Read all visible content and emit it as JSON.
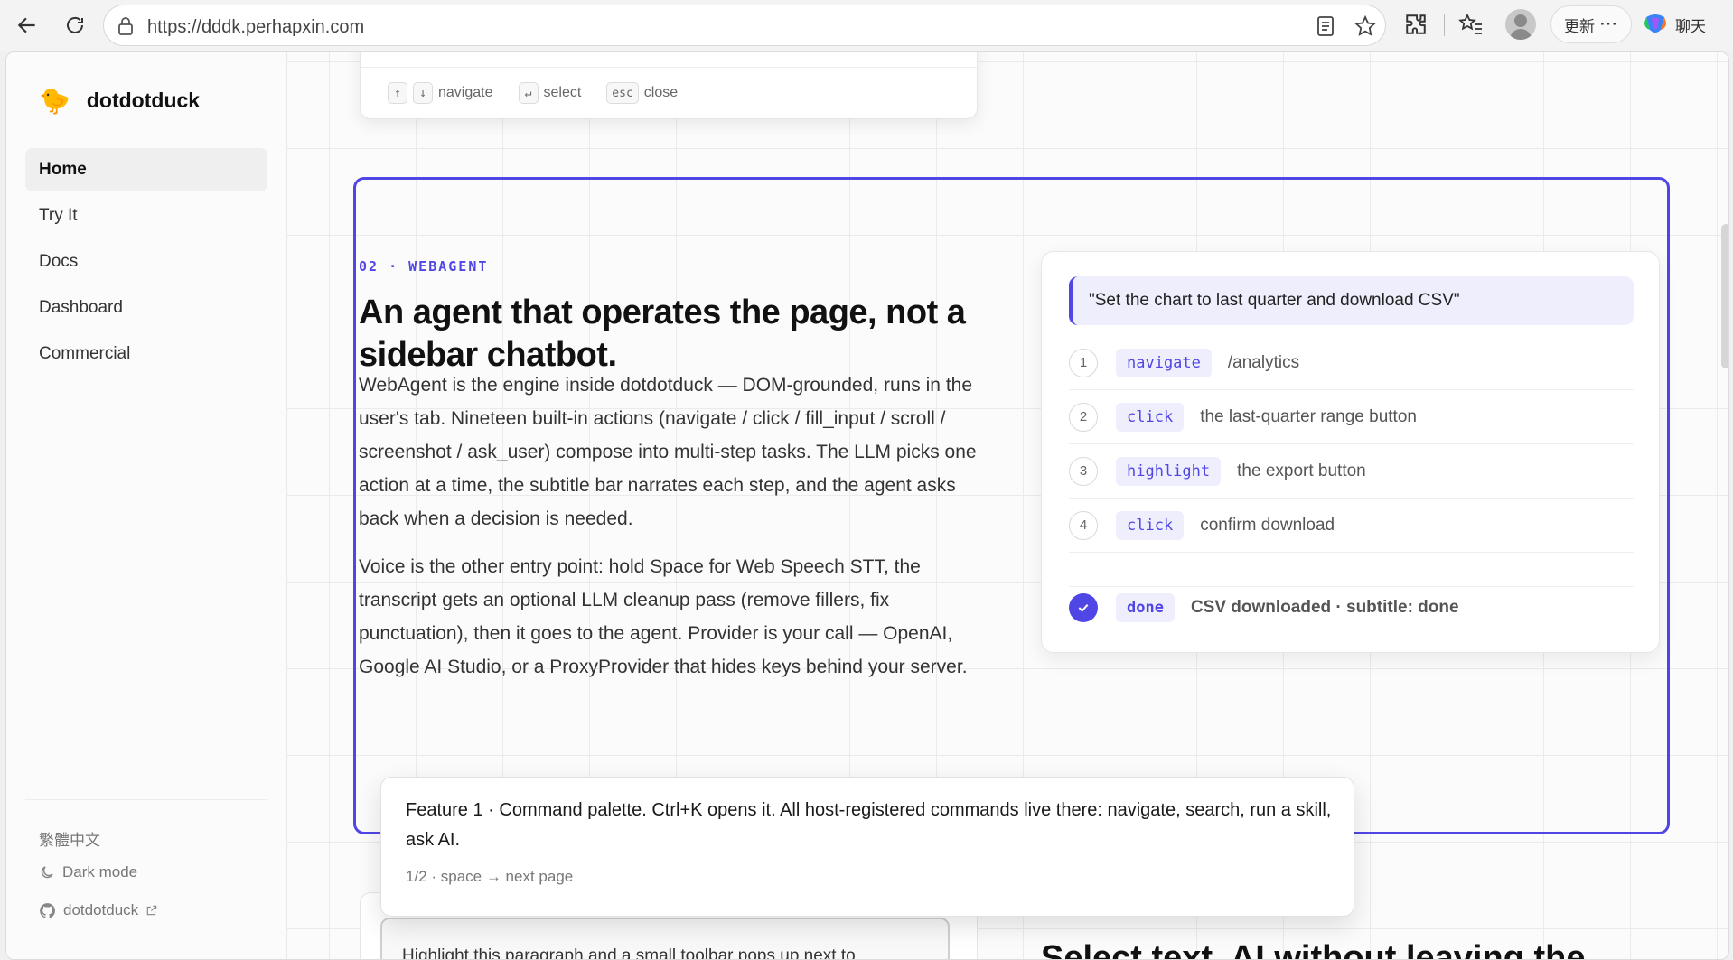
{
  "browser": {
    "url": "https://dddk.perhapxin.com",
    "update_label": "更新",
    "more_label": "···",
    "chat_label": "聊天"
  },
  "sidebar": {
    "brand": "dotdotduck",
    "brand_icon": "🐤",
    "items": [
      {
        "label": "Home",
        "active": true
      },
      {
        "label": "Try It"
      },
      {
        "label": "Docs"
      },
      {
        "label": "Dashboard"
      },
      {
        "label": "Commercial"
      }
    ],
    "language": "繁體中文",
    "dark_mode": "Dark mode",
    "github": "dotdotduck"
  },
  "palette_hints": {
    "up_key": "↑",
    "down_key": "↓",
    "navigate": "navigate",
    "enter_key": "↵",
    "select": "select",
    "esc_key": "esc",
    "close": "close"
  },
  "feature": {
    "label": "02 · WEBAGENT",
    "headline": "An agent that operates the page, not a sidebar chatbot.",
    "paragraph1": "WebAgent is the engine inside dotdotduck — DOM-grounded, runs in the user's tab. Nineteen built-in actions (navigate / click / fill_input / scroll / screenshot / ask_user) compose into multi-step tasks. The LLM picks one action at a time, the subtitle bar narrates each step, and the agent asks back when a decision is needed.",
    "paragraph2": "Voice is the other entry point: hold Space for Web Speech STT, the transcript gets an optional LLM cleanup pass (remove fillers, fix punctuation), then it goes to the agent. Provider is your call — OpenAI, Google AI Studio, or a ProxyProvider that hides keys behind your server."
  },
  "agent_demo": {
    "prompt": "\"Set the chart to last quarter and download CSV\"",
    "steps": [
      {
        "num": "1",
        "action": "navigate",
        "desc": "/analytics"
      },
      {
        "num": "2",
        "action": "click",
        "desc": "the last-quarter range button"
      },
      {
        "num": "3",
        "action": "highlight",
        "desc": "the export button"
      },
      {
        "num": "4",
        "action": "click",
        "desc": "confirm download"
      }
    ],
    "done": {
      "action": "done",
      "desc": "CSV downloaded · subtitle: done"
    }
  },
  "tour_tooltip": {
    "text": "Feature 1 · Command palette. Ctrl+K opens it. All host-registered commands live there: navigate, search, run a skill, ask AI.",
    "pager": "1/2 · space → next page"
  },
  "next_section": {
    "snippet": "Highlight this paragraph and a small toolbar pops up next to",
    "heading": "Select text. AI without leaving the"
  },
  "colors": {
    "accent": "#4f46e5",
    "accent_soft": "#eeeefd"
  }
}
